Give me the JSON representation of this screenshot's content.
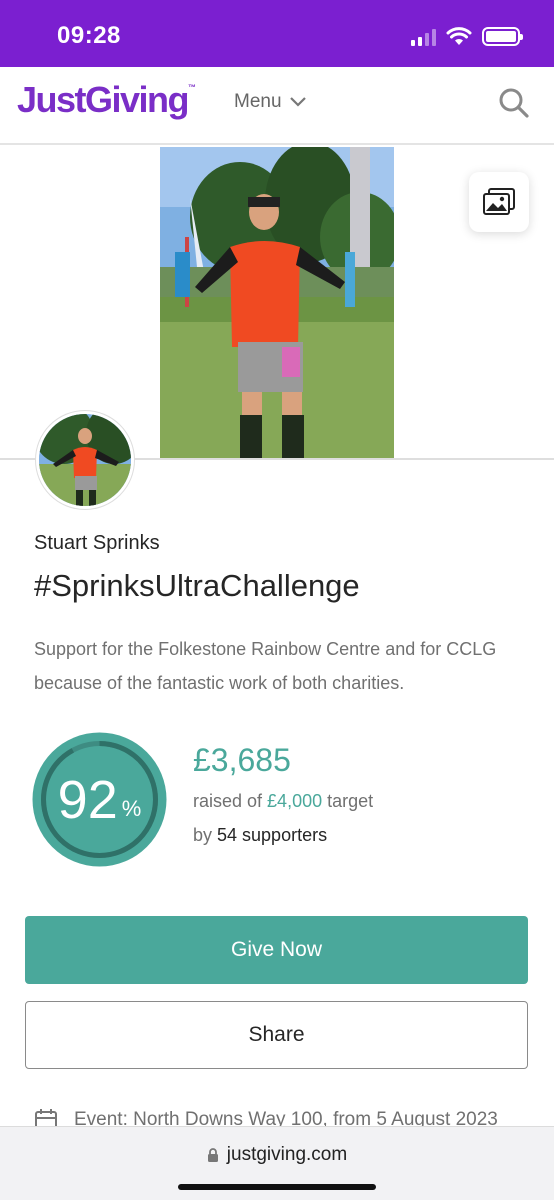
{
  "status_bar": {
    "time": "09:28"
  },
  "nav": {
    "logo": "JustGiving",
    "logo_tm": "™",
    "menu_label": "Menu"
  },
  "page": {
    "owner": "Stuart Sprinks",
    "title": "#SprinksUltraChallenge",
    "story": "Support for the Folkestone Rainbow Centre and for CCLG because of the fantastic work of both charities."
  },
  "progress": {
    "percent_number": "92",
    "percent_sign": "%",
    "percent_value": 0.92,
    "raised_amount": "£3,685",
    "raised_prefix": "raised of ",
    "target_amount": "£4,000",
    "target_suffix": " target",
    "supporters_prefix": "by ",
    "supporters_count": "54 supporters"
  },
  "buttons": {
    "give_label": "Give Now",
    "share_label": "Share"
  },
  "event": {
    "text": "Event: North Downs Way 100, from 5 August 2023"
  },
  "browser": {
    "url": "justgiving.com"
  },
  "colors": {
    "status_bar": "#7b1fd0",
    "brand_purple": "#7a2ec7",
    "teal": "#4aa89b"
  }
}
